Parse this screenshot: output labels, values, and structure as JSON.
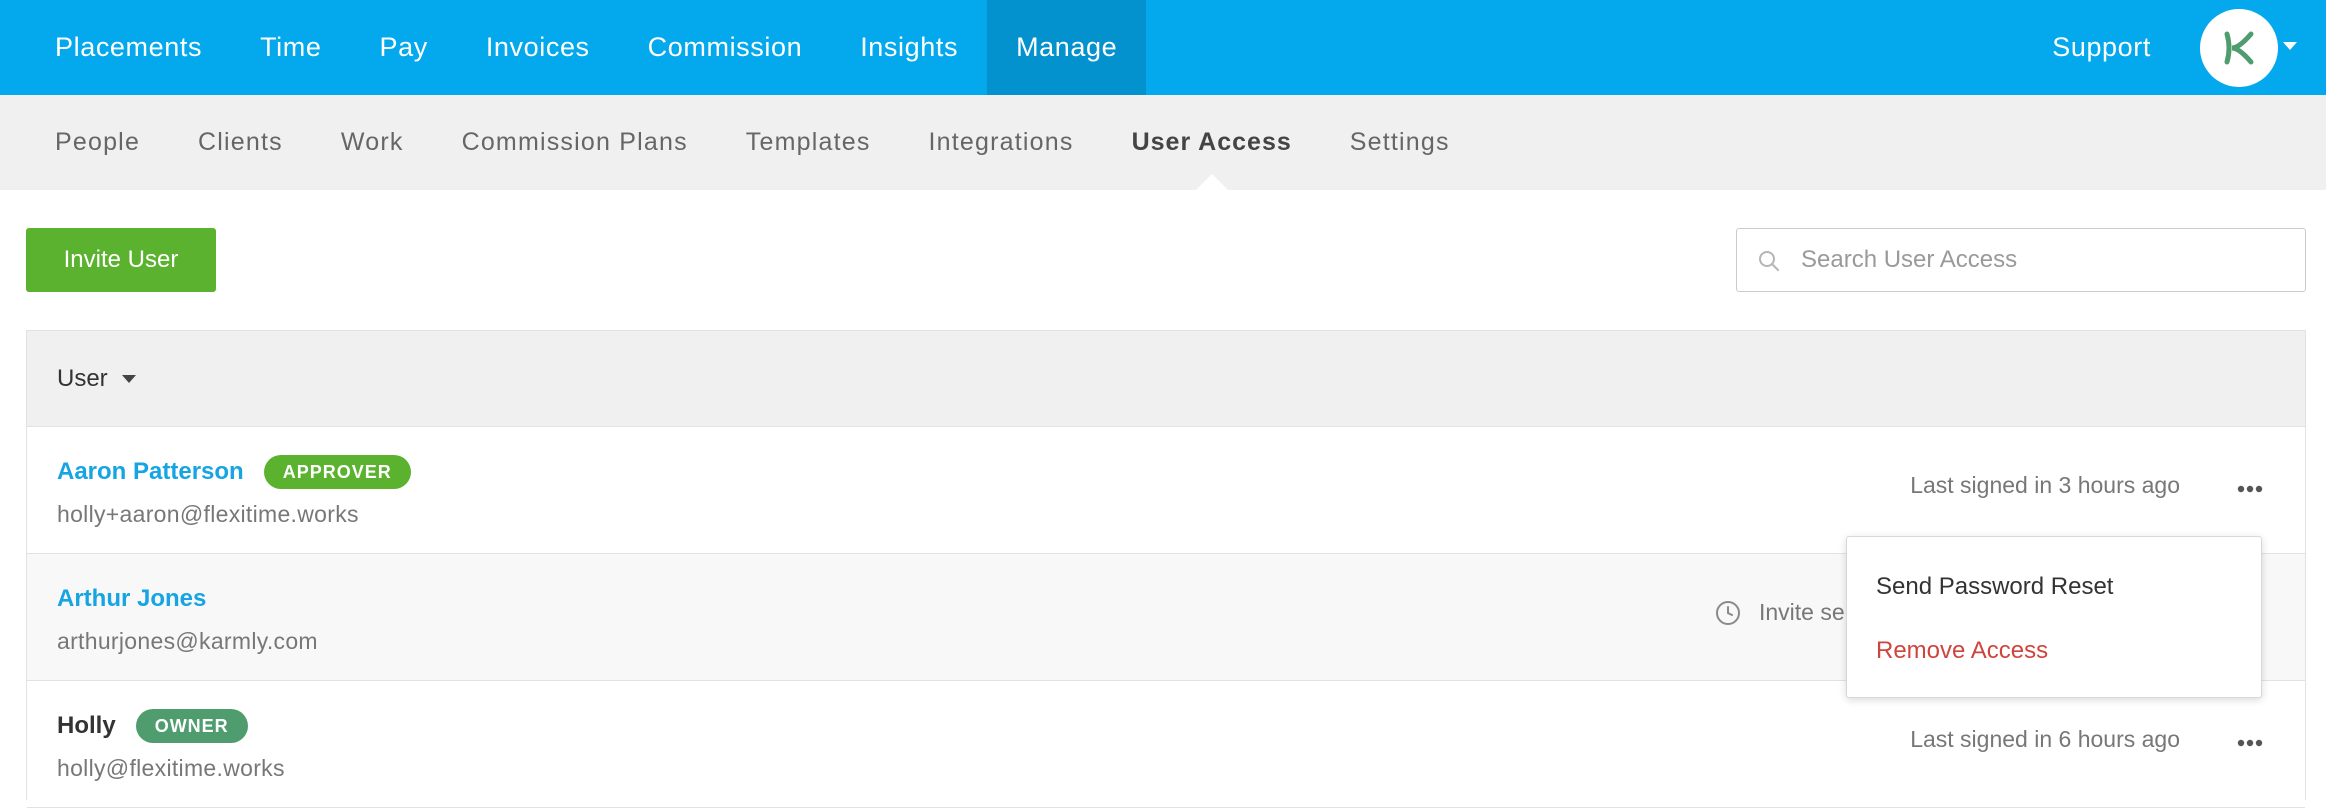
{
  "topnav": {
    "items": [
      {
        "label": "Placements"
      },
      {
        "label": "Time"
      },
      {
        "label": "Pay"
      },
      {
        "label": "Invoices"
      },
      {
        "label": "Commission"
      },
      {
        "label": "Insights"
      },
      {
        "label": "Manage",
        "active": true
      }
    ],
    "support_label": "Support",
    "avatar_icon": "karmly-logo-icon",
    "accent_color": "#03a9ec"
  },
  "subnav": {
    "items": [
      {
        "label": "People"
      },
      {
        "label": "Clients"
      },
      {
        "label": "Work"
      },
      {
        "label": "Commission Plans"
      },
      {
        "label": "Templates"
      },
      {
        "label": "Integrations"
      },
      {
        "label": "User Access",
        "active": true
      },
      {
        "label": "Settings"
      }
    ]
  },
  "toolbar": {
    "invite_label": "Invite User",
    "search_placeholder": "Search User Access",
    "search_value": ""
  },
  "table": {
    "header": {
      "user_label": "User"
    },
    "rows": [
      {
        "name": "Aaron Patterson",
        "badge": "APPROVER",
        "email": "holly+aaron@flexitime.works",
        "status": "Last signed in 3 hours ago"
      },
      {
        "name": "Arthur Jones",
        "badge": "",
        "email": "arthurjones@karmly.com",
        "status": "Invite se"
      },
      {
        "name": "Holly",
        "badge": "OWNER",
        "email": "holly@flexitime.works",
        "status": "Last signed in 6 hours ago"
      }
    ]
  },
  "dropdown": {
    "send_reset_label": "Send Password Reset",
    "remove_label": "Remove Access",
    "remove_color": "#d0443e"
  }
}
